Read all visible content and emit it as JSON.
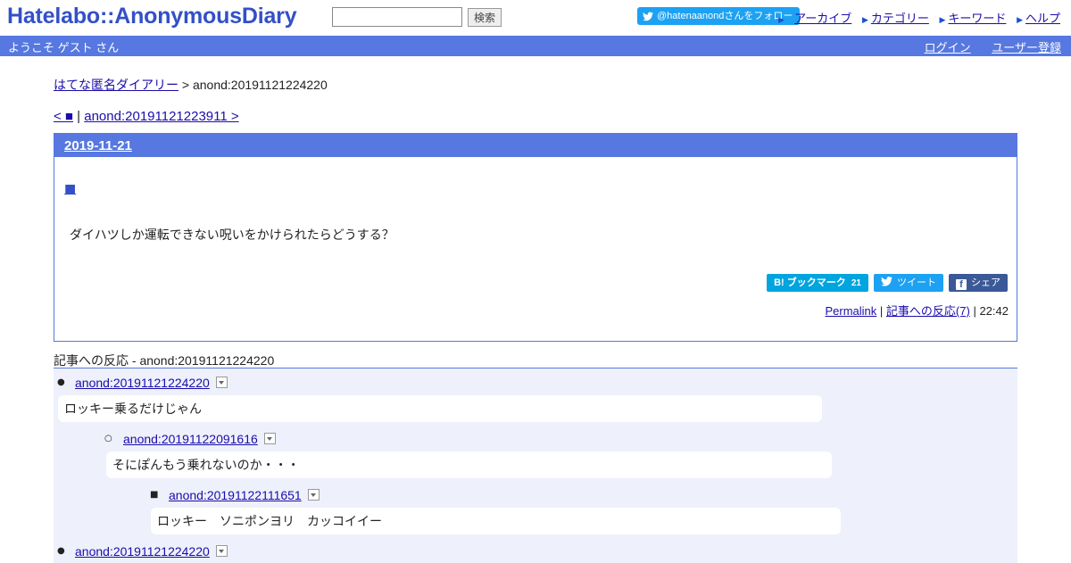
{
  "header": {
    "logo": "Hatelabo::AnonymousDiary",
    "search_placeholder": "",
    "search_button": "検索",
    "twitter_follow": "@hatenaanondさんをフォロー",
    "links": [
      "アーカイブ",
      "カテゴリー",
      "キーワード",
      "ヘルプ"
    ]
  },
  "userbar": {
    "welcome": "ようこそ ゲスト さん",
    "login": "ログイン",
    "register": "ユーザー登録"
  },
  "breadcrumb": {
    "home": "はてな匿名ダイアリー",
    "separator": ">",
    "current": "anond:20191121224220"
  },
  "pager": {
    "prev": "< ■",
    "separator": "|",
    "next": "anond:20191121223911 >"
  },
  "entry": {
    "date": "2019-11-21",
    "title_mark": "■",
    "body": "ダイハツしか運転できない呪いをかけられたらどうする？",
    "share": {
      "hatena": "B! ブックマーク",
      "hatena_count": "21",
      "tweet": "ツイート",
      "facebook": "シェア"
    },
    "meta": {
      "permalink": "Permalink",
      "separator": "|",
      "reactions": "記事への反応(7)",
      "time": "22:42"
    }
  },
  "references": {
    "title": "記事への反応 - anond:20191121224220",
    "items": [
      {
        "id": "anond:20191121224220",
        "text": "ロッキー乗るだけじゃん"
      },
      {
        "id": "anond:20191122091616",
        "text": "そにぽんもう乗れないのか・・・"
      },
      {
        "id": "anond:20191122111651",
        "text": "ロッキー　ソニポンヨリ　カッコイイー"
      },
      {
        "id": "anond:20191121224220",
        "text": ""
      }
    ]
  },
  "colors": {
    "accent": "#5678e0",
    "logo": "#3350c8",
    "twitter": "#1da1f2",
    "hatena": "#00a4de",
    "facebook": "#3b5998",
    "refs_bg": "#eef0fb"
  }
}
